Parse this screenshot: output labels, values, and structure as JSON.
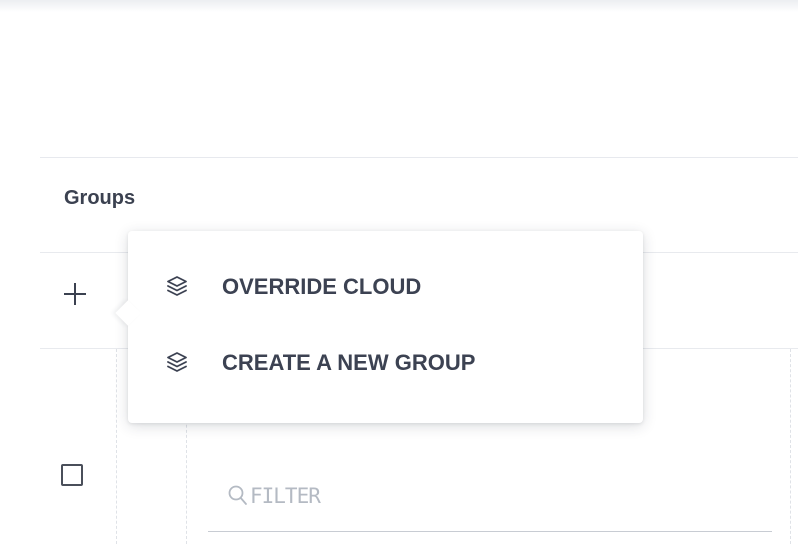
{
  "groups": {
    "title": "Groups"
  },
  "toolbar": {
    "add_icon": "plus-icon"
  },
  "context_menu": {
    "items": [
      {
        "label": "OVERRIDE CLOUD",
        "icon": "layers-icon"
      },
      {
        "label": "CREATE A NEW GROUP",
        "icon": "layers-icon"
      }
    ]
  },
  "filter": {
    "placeholder": "FILTER",
    "value": "",
    "icon": "search-icon"
  },
  "colors": {
    "text": "#3c4252",
    "placeholder": "#b4bac3",
    "border": "#e8eaee"
  }
}
